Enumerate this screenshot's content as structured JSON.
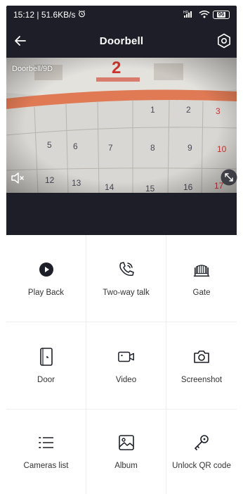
{
  "status_bar": {
    "time_speed": "15:12 | 51.6KB/s",
    "alarm_icon": "alarm-clock-icon",
    "network": "HD",
    "battery": "96"
  },
  "header": {
    "title": "Doorbell",
    "back_icon": "arrow-left-icon",
    "settings_icon": "gear-icon"
  },
  "video": {
    "camera_label": "Doorbell/9D",
    "mute_icon": "speaker-muted-icon",
    "fullscreen_icon": "expand-icon"
  },
  "actions": [
    {
      "label": "Play Back",
      "icon": "play-circle-icon"
    },
    {
      "label": "Two-way talk",
      "icon": "phone-talk-icon"
    },
    {
      "label": "Gate",
      "icon": "gate-icon"
    },
    {
      "label": "Door",
      "icon": "door-icon"
    },
    {
      "label": "Video",
      "icon": "video-camera-icon"
    },
    {
      "label": "Screenshot",
      "icon": "camera-icon"
    },
    {
      "label": "Cameras list",
      "icon": "list-icon"
    },
    {
      "label": "Album",
      "icon": "image-icon"
    },
    {
      "label": "Unlock QR code",
      "icon": "key-icon"
    }
  ]
}
